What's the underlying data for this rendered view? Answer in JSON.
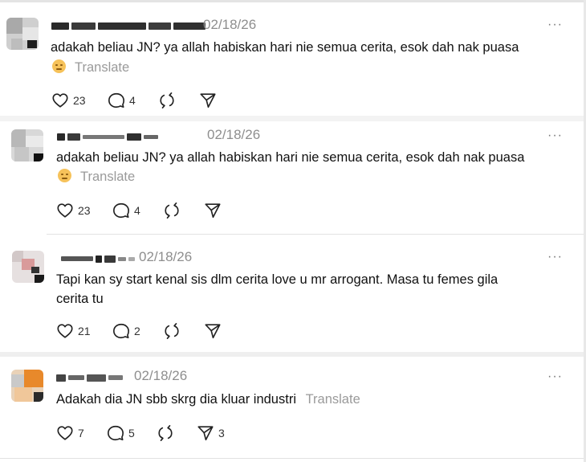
{
  "posts": [
    {
      "date": "02/18/26",
      "text": "adakah beliau JN? ya allah habiskan hari nie semua cerita, esok dah nak puasa",
      "emoji": "neutral-face",
      "translate": "Translate",
      "likes": "23",
      "replies": "4",
      "reposts": "",
      "shares": ""
    },
    {
      "date": "02/18/26",
      "text": "adakah beliau JN? ya allah habiskan hari nie semua cerita, esok dah nak puasa",
      "emoji": "neutral-face",
      "translate": "Translate",
      "likes": "23",
      "replies": "4",
      "reposts": "",
      "shares": ""
    },
    {
      "date": "02/18/26",
      "text_line1": "Tapi kan sy start kenal sis dlm cerita love u mr arrogant. Masa tu femes gila",
      "text_line2": "cerita tu",
      "likes": "21",
      "replies": "2",
      "reposts": "",
      "shares": ""
    },
    {
      "date": "02/18/26",
      "text": "Adakah dia JN sbb skrg dia kluar industri",
      "translate": "Translate",
      "likes": "7",
      "replies": "5",
      "reposts": "",
      "shares": "3"
    }
  ],
  "more_label": "···",
  "icons": [
    "heart-icon",
    "comment-icon",
    "repost-icon",
    "share-icon",
    "more-icon",
    "emoji-icon"
  ],
  "colors": {
    "text": "#111111",
    "muted": "#8e8e8e",
    "divider": "#e2e2e2",
    "emoji": "#f6c25a"
  }
}
